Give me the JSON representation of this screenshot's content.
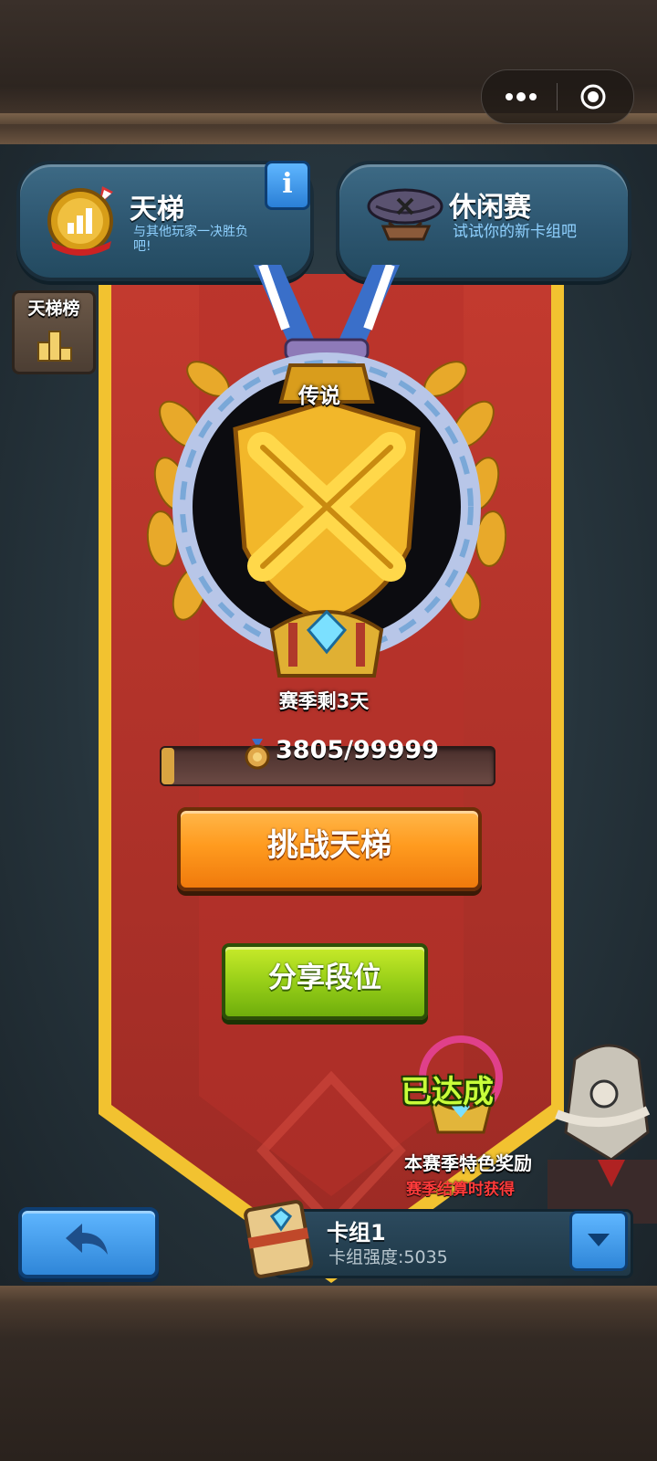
{
  "tabs": {
    "ladder": {
      "title": "天梯",
      "subtitle": "与其他玩家一决胜负吧!"
    },
    "casual": {
      "title": "休闲赛",
      "subtitle": "试试你的新卡组吧"
    }
  },
  "leaderboard_label": "天梯榜",
  "rank": {
    "name": "传说",
    "season_remaining": "赛季剩3天"
  },
  "progress": {
    "text": "3805/99999",
    "current": 3805,
    "max": 99999
  },
  "buttons": {
    "challenge": "挑战天梯",
    "share": "分享段位"
  },
  "reward": {
    "status": "已达成",
    "title": "本赛季特色奖励",
    "subtitle": "赛季结算时获得"
  },
  "deck": {
    "name": "卡组1",
    "power": "卡组强度:5035"
  },
  "colors": {
    "banner_red": "#b3322a",
    "gold_trim": "#f2c230",
    "accent_blue": "#2f86d8",
    "orange": "#ff9b1f",
    "green": "#98cf18"
  }
}
